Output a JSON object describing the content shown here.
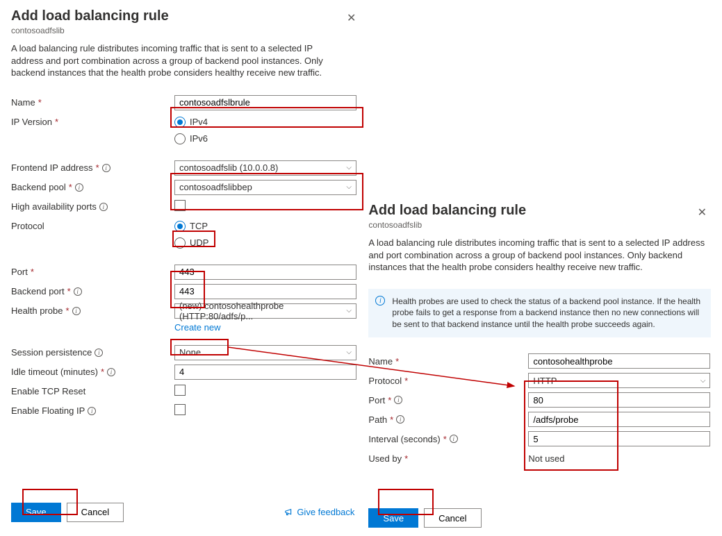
{
  "left": {
    "title": "Add load balancing rule",
    "subtitle": "contosoadfslib",
    "description": "A load balancing rule distributes incoming traffic that is sent to a selected IP address and port combination across a group of backend pool instances. Only backend instances that the health probe considers healthy receive new traffic.",
    "labels": {
      "name": "Name",
      "ip_version": "IP Version",
      "frontend_ip": "Frontend IP address",
      "backend_pool": "Backend pool",
      "ha_ports": "High availability ports",
      "protocol": "Protocol",
      "port": "Port",
      "backend_port": "Backend port",
      "health_probe": "Health probe",
      "create_new": "Create new",
      "session_persistence": "Session persistence",
      "idle_timeout": "Idle timeout (minutes)",
      "tcp_reset": "Enable TCP Reset",
      "floating_ip": "Enable Floating IP"
    },
    "values": {
      "name": "contosoadfslbrule",
      "ipv4": "IPv4",
      "ipv6": "IPv6",
      "frontend_ip": "contosoadfslib (10.0.0.8)",
      "backend_pool": "contosoadfslibbep",
      "tcp": "TCP",
      "udp": "UDP",
      "port": "443",
      "backend_port": "443",
      "health_probe": "(new) contosohealthprobe (HTTP:80/adfs/p...",
      "session_persistence": "None",
      "idle_timeout": "4"
    },
    "buttons": {
      "save": "Save",
      "cancel": "Cancel",
      "feedback": "Give feedback"
    }
  },
  "right": {
    "title": "Add load balancing rule",
    "subtitle": "contosoadfslib",
    "description": "A load balancing rule distributes incoming traffic that is sent to a selected IP address and port combination across a group of backend pool instances. Only backend instances that the health probe considers healthy receive new traffic.",
    "infobox": "Health probes are used to check the status of a backend pool instance. If the health probe fails to get a response from a backend instance then no new connections will be sent to that backend instance until the health probe succeeds again.",
    "labels": {
      "name": "Name",
      "protocol": "Protocol",
      "port": "Port",
      "path": "Path",
      "interval": "Interval (seconds)",
      "used_by": "Used by"
    },
    "values": {
      "name": "contosohealthprobe",
      "protocol": "HTTP",
      "port": "80",
      "path": "/adfs/probe",
      "interval": "5",
      "used_by": "Not used"
    },
    "buttons": {
      "save": "Save",
      "cancel": "Cancel"
    }
  }
}
